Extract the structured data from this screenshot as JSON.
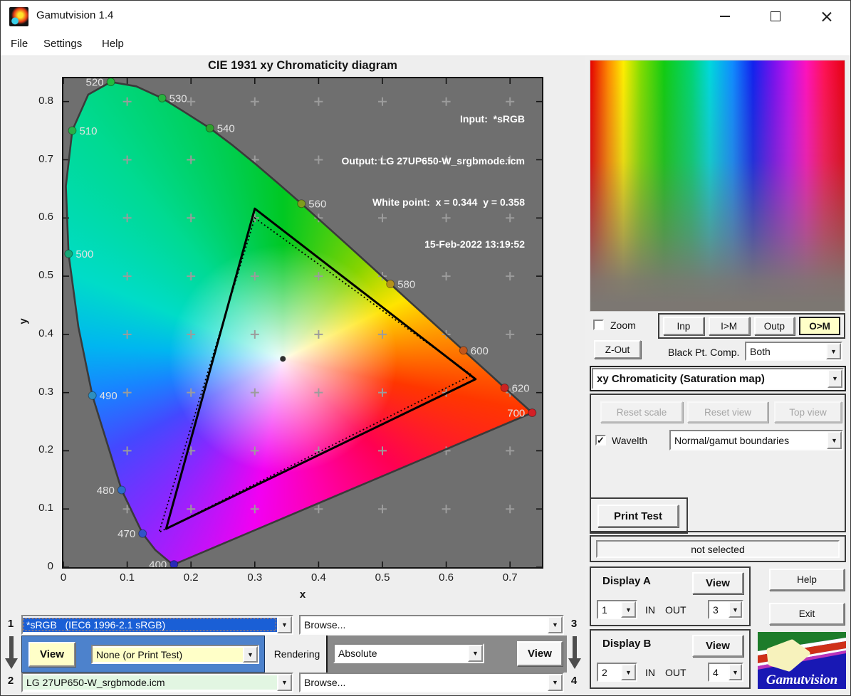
{
  "window": {
    "title": "Gamutvision 1.4",
    "menu": [
      "File",
      "Settings",
      "Help"
    ]
  },
  "chart_data": {
    "type": "scatter",
    "title": "CIE 1931 xy Chromaticity diagram",
    "xlabel": "x",
    "ylabel": "y",
    "xlim": [
      0,
      0.75
    ],
    "ylim": [
      0,
      0.84
    ],
    "xticks": [
      0,
      0.1,
      0.2,
      0.3,
      0.4,
      0.5,
      0.6,
      0.7
    ],
    "xtick_labels": [
      "0",
      "0.1",
      "0.2",
      "0.3",
      "0.4",
      "0.5",
      "0.6",
      "0.7"
    ],
    "yticks": [
      0,
      0.1,
      0.2,
      0.3,
      0.4,
      0.5,
      0.6,
      0.7,
      0.8
    ],
    "ytick_labels": [
      "0",
      "0.1",
      "0.2",
      "0.3",
      "0.4",
      "0.5",
      "0.6",
      "0.7",
      "0.8"
    ],
    "annotations": [
      "Input:  *sRGB",
      "Output: LG 27UP650-W_srgbmode.icm",
      "White point:  x = 0.344  y = 0.358",
      "15-Feb-2022 13:19:52"
    ],
    "white_point": {
      "x": 0.344,
      "y": 0.358
    },
    "grid": "plus-marks at 0.1 intervals",
    "plot_bg": "#6f6f6f",
    "gamut_input": {
      "name": "*sRGB (dotted)",
      "points": [
        [
          0.3,
          0.6
        ],
        [
          0.64,
          0.33
        ],
        [
          0.15,
          0.06
        ]
      ]
    },
    "gamut_output": {
      "name": "LG 27UP650-W_srgbmode.icm (solid)",
      "points": [
        [
          0.3,
          0.616
        ],
        [
          0.646,
          0.323
        ],
        [
          0.161,
          0.066
        ]
      ]
    },
    "spectral_locus": [
      {
        "wl": 400,
        "x": 0.1733,
        "y": 0.0048,
        "label": "400",
        "side": "left",
        "color": "#2a2ab8"
      },
      {
        "wl": 420,
        "x": 0.1714,
        "y": 0.0051
      },
      {
        "wl": 440,
        "x": 0.1644,
        "y": 0.0109
      },
      {
        "wl": 460,
        "x": 0.144,
        "y": 0.0297
      },
      {
        "wl": 470,
        "x": 0.1241,
        "y": 0.0578,
        "label": "470",
        "side": "left",
        "color": "#3252c8"
      },
      {
        "wl": 480,
        "x": 0.0913,
        "y": 0.1327,
        "label": "480",
        "side": "left",
        "color": "#2d6cc8"
      },
      {
        "wl": 490,
        "x": 0.0454,
        "y": 0.295,
        "label": "490",
        "side": "right",
        "color": "#2e8fc0"
      },
      {
        "wl": 495,
        "x": 0.0235,
        "y": 0.4127
      },
      {
        "wl": 500,
        "x": 0.0082,
        "y": 0.5384,
        "label": "500",
        "side": "right",
        "color": "#17a878"
      },
      {
        "wl": 505,
        "x": 0.0039,
        "y": 0.6548
      },
      {
        "wl": 510,
        "x": 0.0139,
        "y": 0.7502,
        "label": "510",
        "side": "right",
        "color": "#27b048"
      },
      {
        "wl": 515,
        "x": 0.0389,
        "y": 0.812
      },
      {
        "wl": 520,
        "x": 0.0743,
        "y": 0.8338,
        "label": "520",
        "side": "left",
        "color": "#22bc3e"
      },
      {
        "wl": 525,
        "x": 0.1142,
        "y": 0.8262
      },
      {
        "wl": 530,
        "x": 0.1547,
        "y": 0.8059,
        "label": "530",
        "side": "right",
        "color": "#28b240"
      },
      {
        "wl": 535,
        "x": 0.1896,
        "y": 0.7822
      },
      {
        "wl": 540,
        "x": 0.2296,
        "y": 0.7543,
        "label": "540",
        "side": "right",
        "color": "#2da22e"
      },
      {
        "wl": 545,
        "x": 0.2658,
        "y": 0.7243
      },
      {
        "wl": 550,
        "x": 0.3016,
        "y": 0.6923
      },
      {
        "wl": 555,
        "x": 0.3373,
        "y": 0.6588
      },
      {
        "wl": 560,
        "x": 0.3731,
        "y": 0.6245,
        "label": "560",
        "side": "right",
        "color": "#7f9c1d"
      },
      {
        "wl": 565,
        "x": 0.4087,
        "y": 0.5896
      },
      {
        "wl": 570,
        "x": 0.4441,
        "y": 0.5547
      },
      {
        "wl": 575,
        "x": 0.4788,
        "y": 0.5202
      },
      {
        "wl": 580,
        "x": 0.5125,
        "y": 0.4866,
        "label": "580",
        "side": "right",
        "color": "#b5921a"
      },
      {
        "wl": 585,
        "x": 0.5448,
        "y": 0.4544
      },
      {
        "wl": 590,
        "x": 0.5752,
        "y": 0.4242
      },
      {
        "wl": 595,
        "x": 0.6029,
        "y": 0.3965
      },
      {
        "wl": 600,
        "x": 0.627,
        "y": 0.3725,
        "label": "600",
        "side": "right",
        "color": "#c2571c"
      },
      {
        "wl": 605,
        "x": 0.6482,
        "y": 0.3514
      },
      {
        "wl": 610,
        "x": 0.6658,
        "y": 0.334
      },
      {
        "wl": 615,
        "x": 0.6801,
        "y": 0.3197
      },
      {
        "wl": 620,
        "x": 0.6915,
        "y": 0.3083,
        "label": "620",
        "side": "right",
        "color": "#cc2222"
      },
      {
        "wl": 635,
        "x": 0.714,
        "y": 0.2859
      },
      {
        "wl": 700,
        "x": 0.7347,
        "y": 0.2653,
        "label": "700",
        "side": "left",
        "color": "#d41f26"
      }
    ]
  },
  "right_panel": {
    "zoom_label": "Zoom",
    "zout_button": "Z-Out",
    "gamut_buttons": [
      "Inp",
      "I>M",
      "Outp",
      "O>M"
    ],
    "bpc_label": "Black Pt. Comp.",
    "bpc_value": "Both",
    "view_mode": "xy Chromaticity (Saturation map)",
    "reset_scale": "Reset scale",
    "reset_view": "Reset view",
    "top_view": "Top view",
    "wavelth_label": "Wavelth",
    "boundaries_value": "Normal/gamut boundaries",
    "print_test": "Print Test",
    "status": "not selected",
    "display_a": {
      "title": "Display A",
      "view": "View",
      "in_value": "1",
      "in_label": "IN",
      "out_label": "OUT",
      "out_value": "3"
    },
    "display_b": {
      "title": "Display B",
      "view": "View",
      "in_value": "2",
      "in_label": "IN",
      "out_label": "OUT",
      "out_value": "4"
    },
    "help_button": "Help",
    "exit_button": "Exit",
    "logo_text": "Gamutvision"
  },
  "bottom_panel": {
    "num1": "1",
    "num2": "2",
    "num3": "3",
    "num4": "4",
    "input_profile": "*sRGB   (IEC6 1996-2.1 sRGB)",
    "browse_top": "Browse...",
    "browse_bottom": "Browse...",
    "view_input": "View",
    "print_test_select": "None (or Print Test)",
    "rendering_label": "Rendering",
    "rendering_intent": "Absolute",
    "view_output": "View",
    "output_profile": "LG 27UP650-W_srgbmode.icm"
  },
  "colors": {
    "selection_blue": "#1a5fd6",
    "highlight_yellow": "#ffffc8",
    "profile_green": "#e2f6e2",
    "panel_blue": "#4d82cc",
    "panel_gray": "#8a8a8a",
    "plot_gray": "#6f6f6f"
  }
}
